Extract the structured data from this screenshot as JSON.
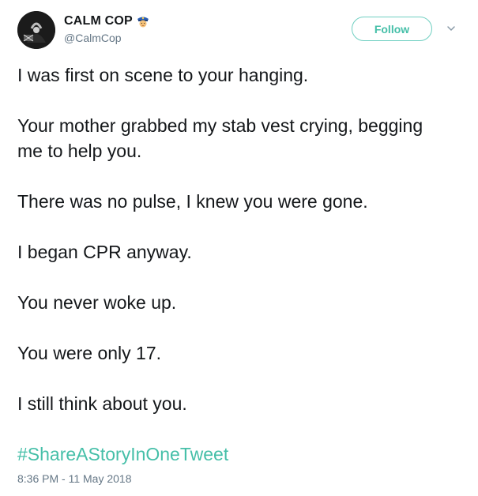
{
  "author": {
    "display_name": "CALM COP",
    "handle": "@CalmCop",
    "name_emoji": "police-officer-icon"
  },
  "actions": {
    "follow_label": "Follow",
    "more_icon": "chevron-down-icon"
  },
  "tweet": {
    "paragraphs": [
      "I was first on scene to your hanging.",
      "Your mother grabbed my stab vest crying, begging me to help you.",
      "There was no pulse, I knew you were gone.",
      "I began CPR anyway.",
      "You never woke up.",
      "You were only 17.",
      "I still think about you."
    ],
    "hashtag": "#ShareAStoryInOneTweet",
    "timestamp": "8:36 PM - 11 May 2018"
  },
  "colors": {
    "accent": "#45bfa8",
    "text": "#14171a",
    "secondary": "#657786"
  }
}
